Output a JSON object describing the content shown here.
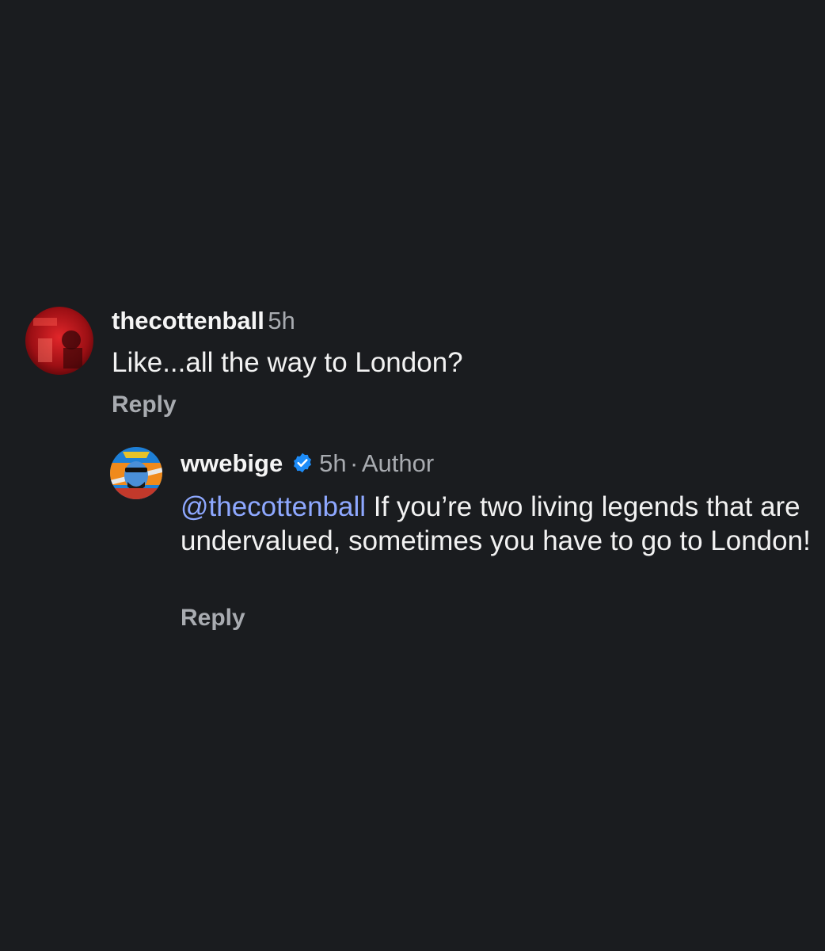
{
  "comments": [
    {
      "username": "thecottenball",
      "time": "5h",
      "text": "Like...all the way to London?",
      "reply_label": "Reply",
      "avatar_color": "#c0171a"
    },
    {
      "username": "wwebige",
      "verified_icon": "verified-badge-icon",
      "time": "5h",
      "separator": "·",
      "author_label": "Author",
      "mention": "@thecottenball",
      "text": " If you’re two living legends that are undervalued, sometimes you have to go to London!",
      "reply_label": "Reply",
      "avatar_color": "#f08a1c"
    }
  ],
  "colors": {
    "background": "#1a1c1f",
    "secondary_text": "#a8abb0",
    "mention": "#8ea8ff",
    "verified": "#1d8cf8"
  }
}
